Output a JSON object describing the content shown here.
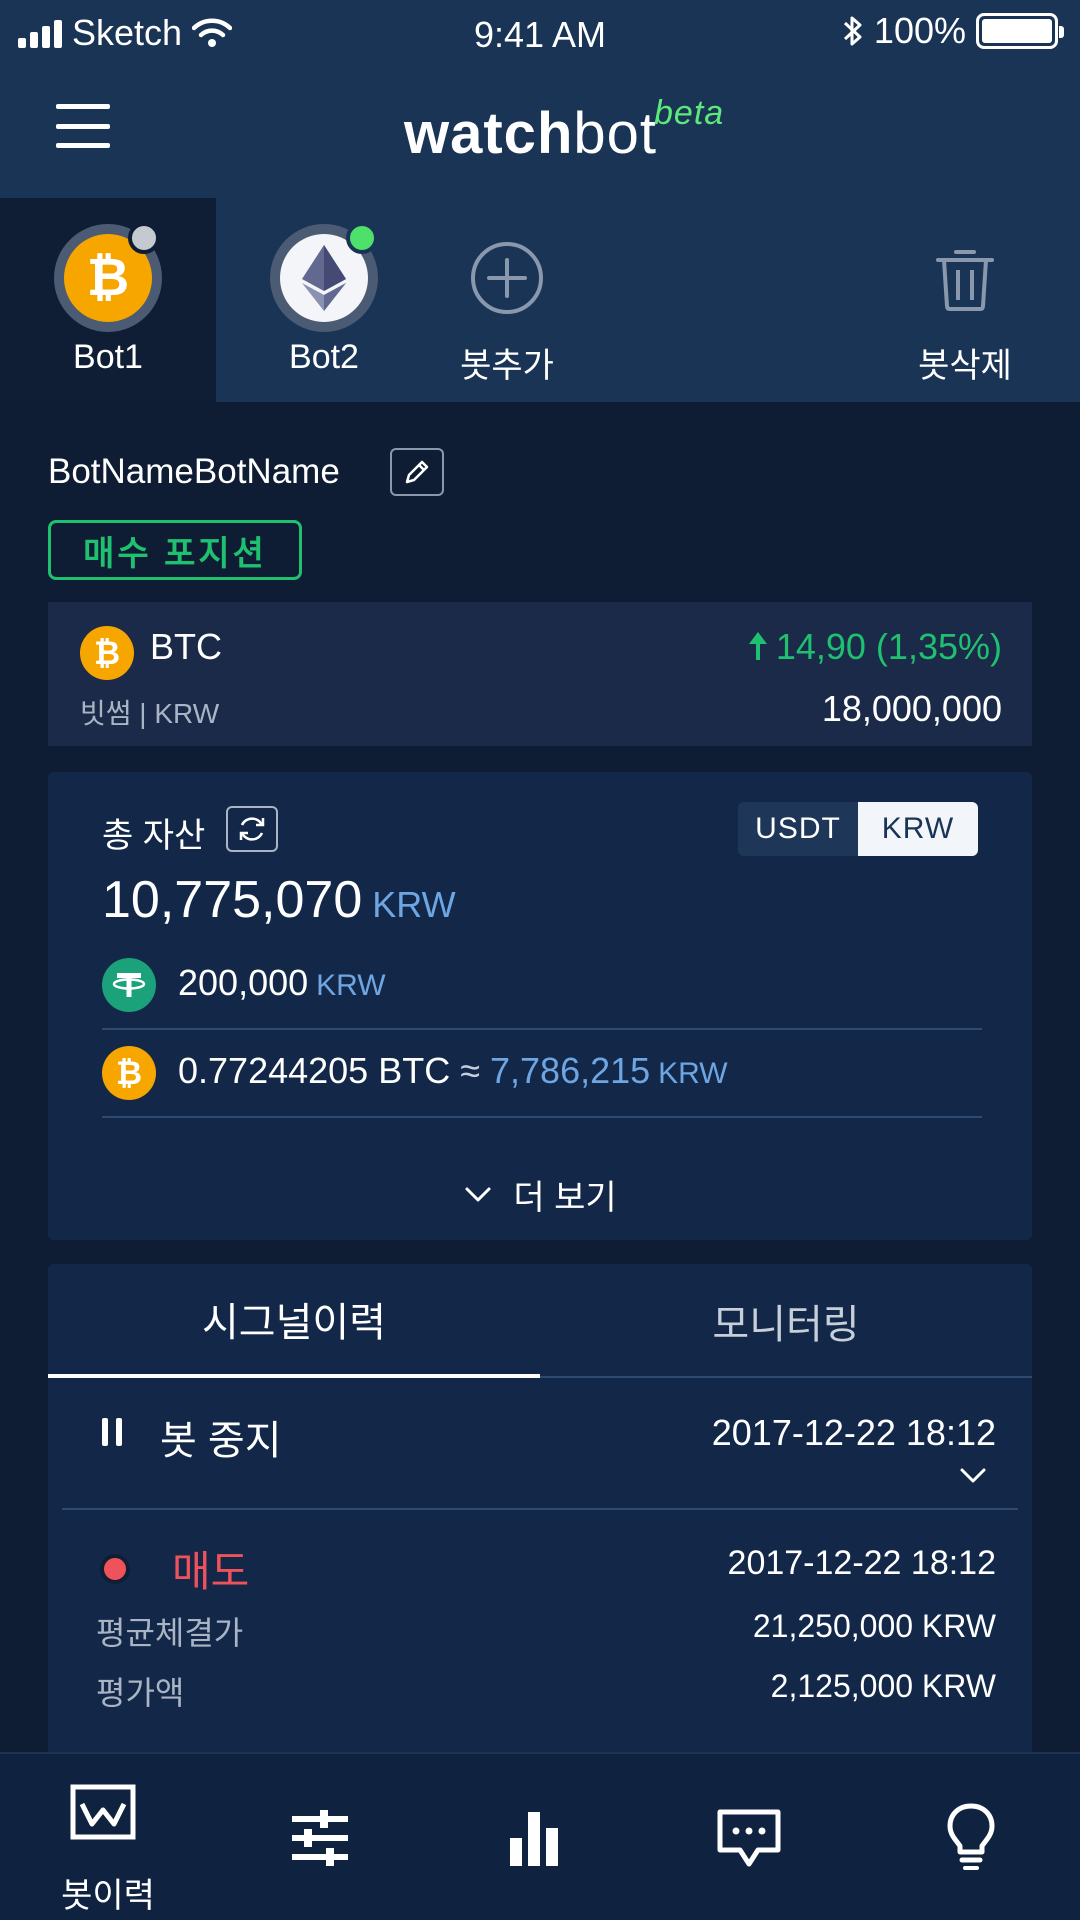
{
  "status_bar": {
    "carrier": "Sketch",
    "time": "9:41 AM",
    "battery": "100%"
  },
  "header": {
    "logo_part1": "watch",
    "logo_part2": "bot",
    "logo_badge": "beta"
  },
  "bots": [
    {
      "label": "Bot1",
      "coin": "btc",
      "status_color": "#c5cad1",
      "active": true
    },
    {
      "label": "Bot2",
      "coin": "eth",
      "status_color": "#4de06a",
      "active": false
    }
  ],
  "bot_actions": {
    "add_label": "봇추가",
    "delete_label": "봇삭제"
  },
  "bot_info": {
    "name": "BotNameBotName",
    "position_badge": "매수 포지션"
  },
  "ticker": {
    "symbol": "BTC",
    "exchange": "빗썸 | KRW",
    "change": "14,90 (1,35%)",
    "price": "18,000,000"
  },
  "assets": {
    "title": "총 자산",
    "currency_options": [
      "USDT",
      "KRW"
    ],
    "selected_currency": "KRW",
    "total_value": "10,775,070",
    "total_unit": "KRW",
    "holdings": [
      {
        "coin": "usdt",
        "amount": "200,000",
        "converted": "",
        "unit": "KRW"
      },
      {
        "coin": "btc",
        "amount": "0.77244205 BTC",
        "approx": "≈",
        "converted": "7,786,215",
        "unit": "KRW"
      }
    ],
    "more_label": "더 보기"
  },
  "history": {
    "tabs": [
      "시그널이력",
      "모니터링"
    ],
    "active_tab": 0,
    "events": [
      {
        "icon": "pause",
        "label": "봇 중지",
        "time": "2017-12-22 18:12"
      },
      {
        "icon": "sell-dot",
        "label": "매도",
        "time": "2017-12-22 18:12",
        "details": [
          {
            "key": "평균체결가",
            "value": "21,250,000 KRW"
          },
          {
            "key": "평가액",
            "value": "2,125,000 KRW"
          }
        ]
      }
    ]
  },
  "tabbar": {
    "items": [
      {
        "icon": "bot-history-icon",
        "label": "봇이력",
        "active": true
      },
      {
        "icon": "sliders-icon",
        "label": "",
        "active": false
      },
      {
        "icon": "bar-chart-icon",
        "label": "",
        "active": false
      },
      {
        "icon": "chat-icon",
        "label": "",
        "active": false
      },
      {
        "icon": "lightbulb-icon",
        "label": "",
        "active": false
      }
    ]
  },
  "colors": {
    "background": "#0e1d33",
    "header": "#1a3456",
    "positive": "#1fc070",
    "negative": "#f0525b",
    "accent_blue": "#6ea6e3",
    "btc": "#f7a600",
    "usdt": "#1ba27a"
  }
}
